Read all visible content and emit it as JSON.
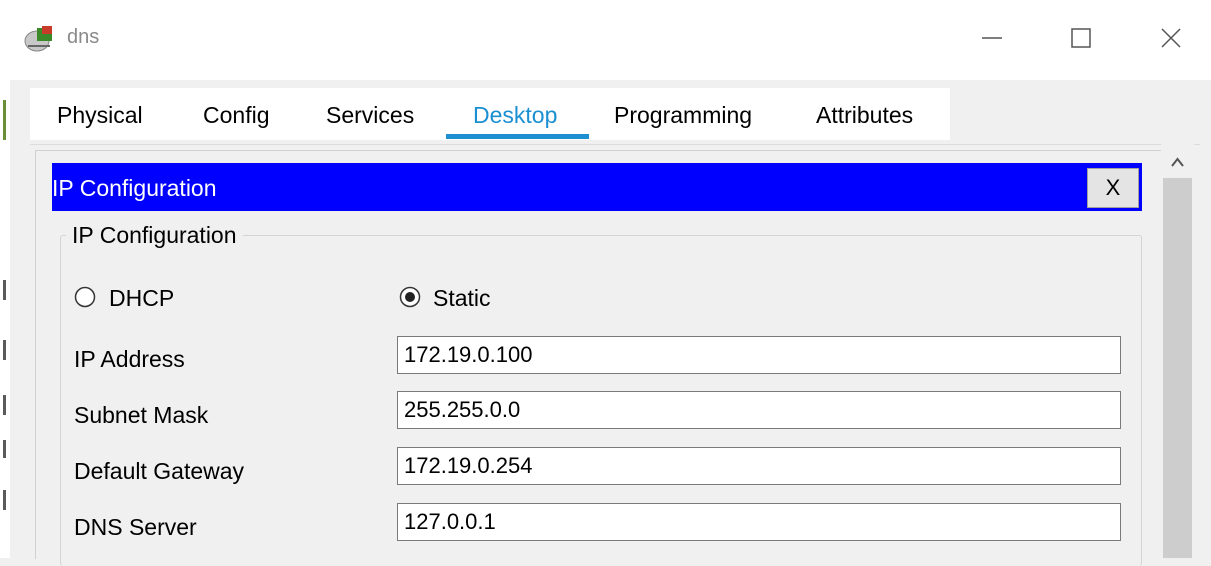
{
  "window": {
    "title": "dns"
  },
  "tabs": [
    {
      "label": "Physical",
      "active": false
    },
    {
      "label": "Config",
      "active": false
    },
    {
      "label": "Services",
      "active": false
    },
    {
      "label": "Desktop",
      "active": true
    },
    {
      "label": "Programming",
      "active": false
    },
    {
      "label": "Attributes",
      "active": false
    }
  ],
  "ip_config": {
    "header": "IP Configuration",
    "close_label": "X",
    "group_title": "IP Configuration",
    "mode_options": [
      {
        "label": "DHCP",
        "selected": false
      },
      {
        "label": "Static",
        "selected": true
      }
    ],
    "fields": [
      {
        "label": "IP Address",
        "value": "172.19.0.100"
      },
      {
        "label": "Subnet Mask",
        "value": "255.255.0.0"
      },
      {
        "label": "Default Gateway",
        "value": "172.19.0.254"
      },
      {
        "label": "DNS Server",
        "value": "127.0.0.1"
      }
    ]
  },
  "colors": {
    "header_bg": "#0000ff",
    "active_tab": "#1a8fd1"
  },
  "icons": {
    "app": "network-device-icon",
    "minimize": "minimize-icon",
    "maximize": "maximize-icon",
    "close": "close-icon",
    "scroll_up": "chevron-up-icon"
  }
}
